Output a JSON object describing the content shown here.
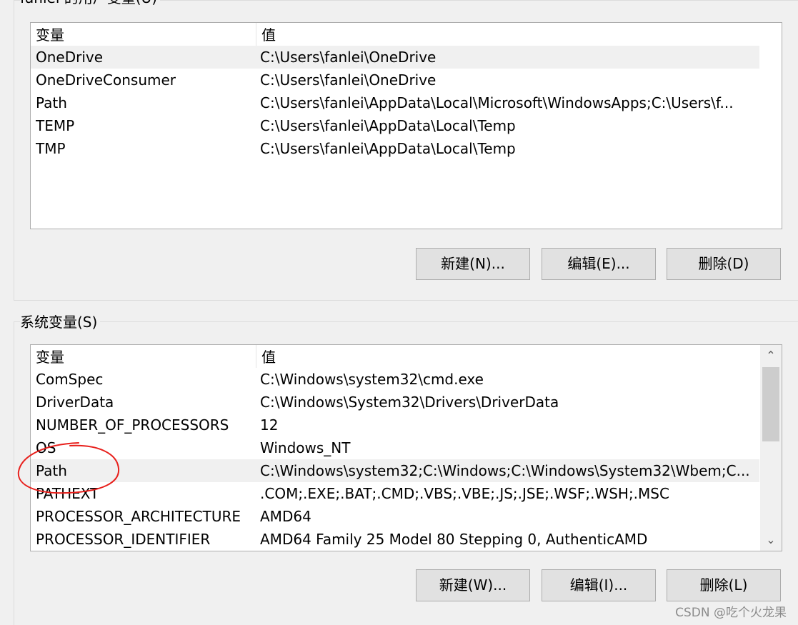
{
  "user_vars": {
    "group_title": "fanlei 的用户变量(U)",
    "headers": [
      "变量",
      "值"
    ],
    "rows": [
      {
        "name": "OneDrive",
        "value": "C:\\Users\\fanlei\\OneDrive"
      },
      {
        "name": "OneDriveConsumer",
        "value": "C:\\Users\\fanlei\\OneDrive"
      },
      {
        "name": "Path",
        "value": "C:\\Users\\fanlei\\AppData\\Local\\Microsoft\\WindowsApps;C:\\Users\\f..."
      },
      {
        "name": "TEMP",
        "value": "C:\\Users\\fanlei\\AppData\\Local\\Temp"
      },
      {
        "name": "TMP",
        "value": "C:\\Users\\fanlei\\AppData\\Local\\Temp"
      }
    ],
    "buttons": {
      "new": "新建(N)...",
      "edit": "编辑(E)...",
      "delete": "删除(D)"
    }
  },
  "system_vars": {
    "group_title": "系统变量(S)",
    "headers": [
      "变量",
      "值"
    ],
    "rows": [
      {
        "name": "ComSpec",
        "value": "C:\\Windows\\system32\\cmd.exe"
      },
      {
        "name": "DriverData",
        "value": "C:\\Windows\\System32\\Drivers\\DriverData"
      },
      {
        "name": "NUMBER_OF_PROCESSORS",
        "value": "12"
      },
      {
        "name": "OS",
        "value": "Windows_NT"
      },
      {
        "name": "Path",
        "value": "C:\\Windows\\system32;C:\\Windows;C:\\Windows\\System32\\Wbem;C..."
      },
      {
        "name": "PATHEXT",
        "value": ".COM;.EXE;.BAT;.CMD;.VBS;.VBE;.JS;.JSE;.WSF;.WSH;.MSC"
      },
      {
        "name": "PROCESSOR_ARCHITECTURE",
        "value": "AMD64"
      },
      {
        "name": "PROCESSOR_IDENTIFIER",
        "value": "AMD64 Family 25 Model 80 Stepping 0, AuthenticAMD"
      }
    ],
    "buttons": {
      "new": "新建(W)...",
      "edit": "编辑(I)...",
      "delete": "删除(L)"
    }
  },
  "scrollbar": {
    "up_icon": "chevron-up-icon",
    "down_icon": "chevron-down-icon"
  },
  "watermark": "CSDN @吃个火龙果",
  "colors": {
    "annotation_circle": "#e8201c",
    "selected_row": "#f0f0f0",
    "button_face": "#e1e1e1"
  }
}
